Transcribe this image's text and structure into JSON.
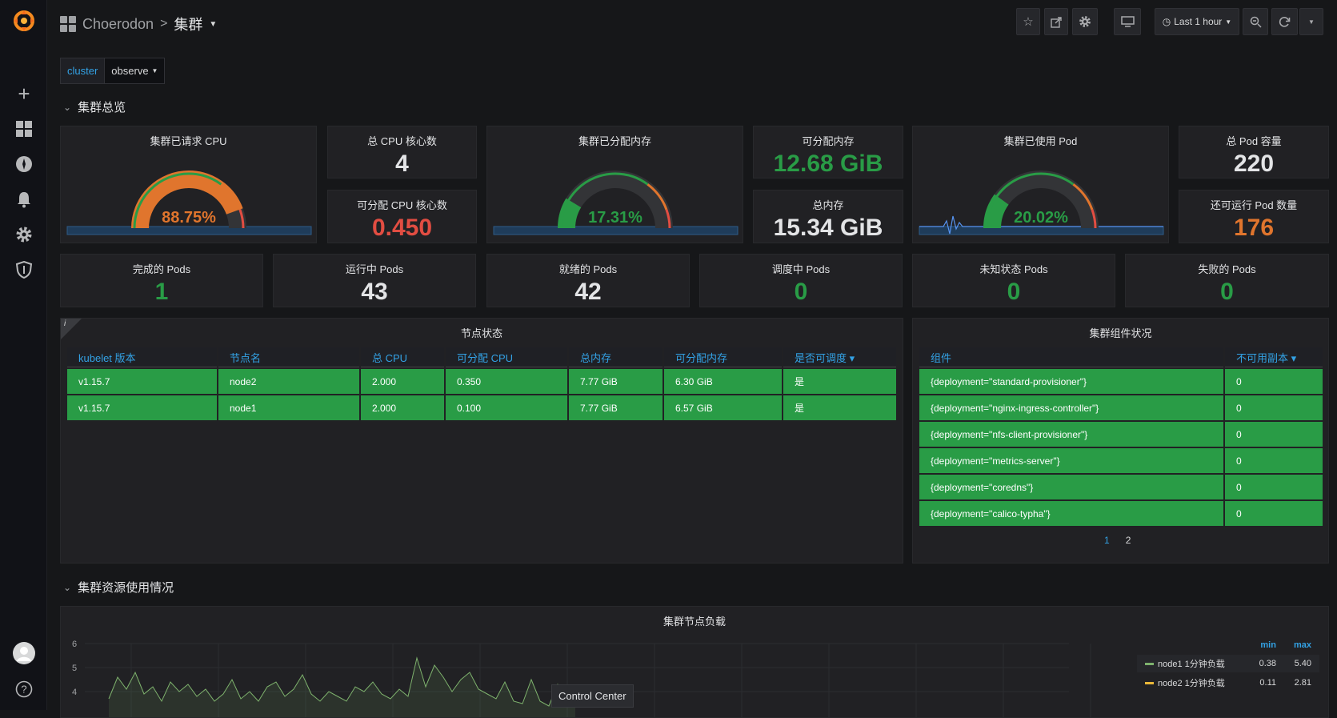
{
  "header": {
    "folder": "Choerodon",
    "separator": ">",
    "title": "集群",
    "time_range": "Last 1 hour"
  },
  "variables": [
    {
      "label": "cluster",
      "value": "observe"
    }
  ],
  "rows": {
    "overview": "集群总览",
    "resources": "集群资源使用情况"
  },
  "overview_panels": {
    "cpu_requested": {
      "title": "集群已请求 CPU",
      "value": "88.75%",
      "percent": 88.75,
      "color": "#e0752d"
    },
    "total_cpu": {
      "title": "总 CPU 核心数",
      "value": "4",
      "color": "#e3e4e6"
    },
    "allocatable_cpu": {
      "title": "可分配 CPU 核心数",
      "value": "0.450",
      "color": "#e24d42"
    },
    "mem_allocated": {
      "title": "集群已分配内存",
      "value": "17.31%",
      "percent": 17.31,
      "color": "#299c46"
    },
    "allocatable_mem": {
      "title": "可分配内存",
      "value": "12.68 GiB",
      "color": "#299c46"
    },
    "total_mem": {
      "title": "总内存",
      "value": "15.34 GiB",
      "color": "#e3e4e6"
    },
    "pods_used": {
      "title": "集群已使用 Pod",
      "value": "20.02%",
      "percent": 20.02,
      "color": "#299c46"
    },
    "pod_capacity": {
      "title": "总 Pod 容量",
      "value": "220",
      "color": "#e3e4e6"
    },
    "pods_remaining": {
      "title": "还可运行 Pod 数量",
      "value": "176",
      "color": "#e0752d"
    }
  },
  "pod_stats": [
    {
      "title": "完成的 Pods",
      "value": "1",
      "color": "#299c46"
    },
    {
      "title": "运行中 Pods",
      "value": "43",
      "color": "#e3e4e6"
    },
    {
      "title": "就绪的 Pods",
      "value": "42",
      "color": "#e3e4e6"
    },
    {
      "title": "调度中 Pods",
      "value": "0",
      "color": "#299c46"
    },
    {
      "title": "未知状态 Pods",
      "value": "0",
      "color": "#299c46"
    },
    {
      "title": "失败的 Pods",
      "value": "0",
      "color": "#299c46"
    }
  ],
  "node_status": {
    "title": "节点状态",
    "info": "i",
    "columns": [
      "kubelet 版本",
      "节点名",
      "总 CPU",
      "可分配 CPU",
      "总内存",
      "可分配内存",
      "是否可调度 ▾"
    ],
    "rows": [
      [
        "v1.15.7",
        "node2",
        "2.000",
        "0.350",
        "7.77 GiB",
        "6.30 GiB",
        "是"
      ],
      [
        "v1.15.7",
        "node1",
        "2.000",
        "0.100",
        "7.77 GiB",
        "6.57 GiB",
        "是"
      ]
    ]
  },
  "components": {
    "title": "集群组件状况",
    "columns": [
      "组件",
      "不可用副本 ▾"
    ],
    "rows": [
      [
        "{deployment=\"standard-provisioner\"}",
        "0"
      ],
      [
        "{deployment=\"nginx-ingress-controller\"}",
        "0"
      ],
      [
        "{deployment=\"nfs-client-provisioner\"}",
        "0"
      ],
      [
        "{deployment=\"metrics-server\"}",
        "0"
      ],
      [
        "{deployment=\"coredns\"}",
        "0"
      ],
      [
        "{deployment=\"calico-typha\"}",
        "0"
      ]
    ],
    "pages": [
      "1",
      "2"
    ]
  },
  "load_chart": {
    "title": "集群节点负载",
    "legend_header": [
      "min",
      "max"
    ],
    "tooltip": "Control Center"
  },
  "chart_data": {
    "type": "line",
    "title": "集群节点负载",
    "y_ticks": [
      "6",
      "5",
      "4"
    ],
    "ylim": [
      3.3,
      6
    ],
    "legend_placement": "right",
    "series": [
      {
        "name": "node1 1分钟负载",
        "color": "#7eb26d",
        "min": "0.38",
        "max": "5.40",
        "values": [
          3.7,
          4.6,
          4.1,
          4.8,
          3.9,
          4.2,
          3.6,
          4.4,
          4.0,
          4.3,
          3.8,
          4.1,
          3.6,
          3.9,
          4.5,
          3.7,
          4.0,
          3.6,
          4.2,
          4.4,
          3.8,
          4.1,
          4.7,
          3.9,
          3.6,
          4.0,
          3.8,
          3.6,
          4.2,
          4.0,
          4.4,
          3.9,
          3.7,
          4.1,
          3.8,
          5.4,
          4.2,
          5.1,
          4.6,
          4.0,
          4.5,
          4.8,
          4.1,
          3.9,
          3.7,
          4.4,
          3.6,
          3.5,
          4.5,
          3.6,
          3.4,
          4.3,
          3.7,
          3.5
        ]
      },
      {
        "name": "node2 1分钟负载",
        "color": "#eab839",
        "min": "0.11",
        "max": "2.81",
        "values": []
      }
    ]
  }
}
